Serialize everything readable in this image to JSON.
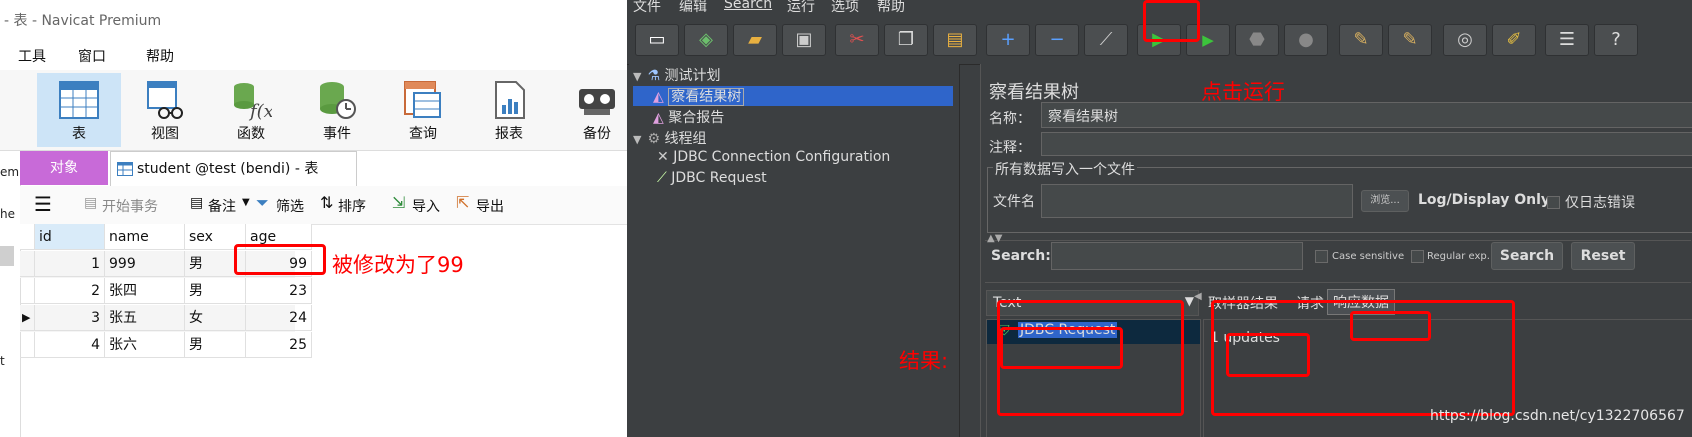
{
  "navicat": {
    "title": "- 表 - Navicat Premium",
    "menu": [
      "工具",
      "窗口",
      "帮助"
    ],
    "toolbar": [
      {
        "label": "表",
        "icon": "table-icon",
        "active": true
      },
      {
        "label": "视图",
        "icon": "view-icon"
      },
      {
        "label": "函数",
        "icon": "function-icon"
      },
      {
        "label": "事件",
        "icon": "event-icon"
      },
      {
        "label": "查询",
        "icon": "query-icon"
      },
      {
        "label": "报表",
        "icon": "report-icon"
      },
      {
        "label": "备份",
        "icon": "backup-icon"
      }
    ],
    "left_strip": [
      "em",
      "he",
      "t"
    ],
    "tabs": {
      "objects": "对象",
      "student": "student @test (bendi) - 表"
    },
    "table_toolbar": {
      "begin_transaction": "开始事务",
      "memo": "备注",
      "filter": "筛选",
      "sort": "排序",
      "import": "导入",
      "export": "导出"
    },
    "grid": {
      "columns": [
        "id",
        "name",
        "sex",
        "age"
      ],
      "rows": [
        {
          "id": "1",
          "name": "999",
          "sex": "男",
          "age": "99"
        },
        {
          "id": "2",
          "name": "张四",
          "sex": "男",
          "age": "23"
        },
        {
          "id": "3",
          "name": "张五",
          "sex": "女",
          "age": "24"
        },
        {
          "id": "4",
          "name": "张六",
          "sex": "男",
          "age": "25"
        }
      ]
    },
    "annotation": "被修改为了99"
  },
  "jmeter": {
    "menu": [
      "文件",
      "编辑",
      "Search",
      "运行",
      "选项",
      "帮助"
    ],
    "tree": [
      {
        "label": "测试计划",
        "icon": "flask-icon",
        "arrow": "▼",
        "indent": 0
      },
      {
        "label": "察看结果树",
        "icon": "listener-icon",
        "indent": 1,
        "selected": true
      },
      {
        "label": "聚合报告",
        "icon": "listener-icon",
        "indent": 1
      },
      {
        "label": "线程组",
        "icon": "gear-icon",
        "arrow": "▼",
        "indent": 0
      },
      {
        "label": "JDBC Connection Configuration",
        "icon": "wrench-icon",
        "indent": 1
      },
      {
        "label": "JDBC Request",
        "icon": "pipette-icon",
        "indent": 1
      }
    ],
    "panel": {
      "title": "察看结果树",
      "name_label": "名称：",
      "name_value": "察看结果树",
      "comment_label": "注释：",
      "file_section": "所有数据写入一个文件",
      "filename_label": "文件名",
      "browse": "浏览...",
      "log_display": "Log/Display Only:",
      "errors_only": "仅日志错误",
      "search_label": "Search:",
      "case_sensitive": "Case sensitive",
      "regular_exp": "Regular exp.",
      "search_btn": "Search",
      "reset_btn": "Reset",
      "renderer": "Text",
      "result_item": "JDBC Request",
      "tabs": [
        "取样器结果",
        "请求",
        "响应数据"
      ],
      "response": "1 updates"
    },
    "annotations": {
      "run": "点击运行",
      "result": "结果:"
    }
  },
  "watermark": "https://blog.csdn.net/cy1322706567"
}
